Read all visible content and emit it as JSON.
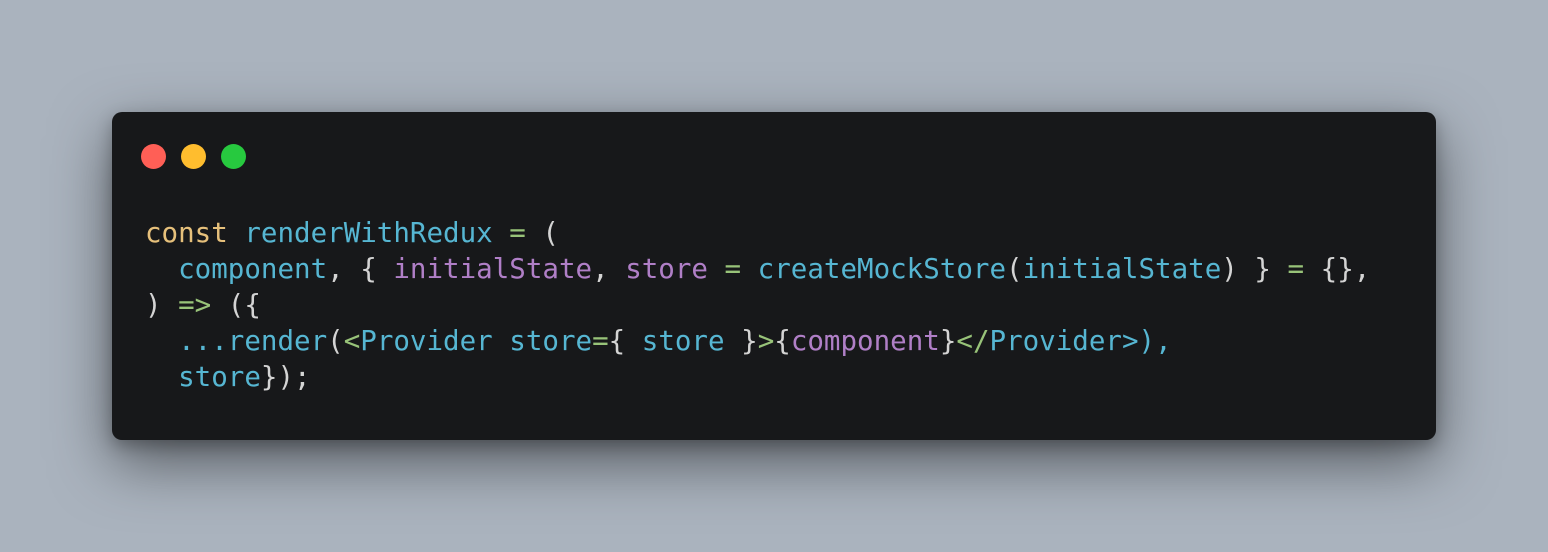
{
  "window": {
    "controls": [
      {
        "name": "close",
        "color": "#ff5f56"
      },
      {
        "name": "minimize",
        "color": "#ffbd2e"
      },
      {
        "name": "maximize",
        "color": "#27c93f"
      }
    ]
  },
  "colors": {
    "keyword": "#e6c07b",
    "identifier": "#56b6d2",
    "parameter": "#b07fc7",
    "operator": "#98c379",
    "punctuation": "#d4d4d4"
  },
  "code": {
    "lines": [
      [
        {
          "text": "const",
          "kind": "keyword"
        },
        {
          "text": " ",
          "kind": "punctuation"
        },
        {
          "text": "renderWithRedux",
          "kind": "identifier"
        },
        {
          "text": " ",
          "kind": "punctuation"
        },
        {
          "text": "=",
          "kind": "operator"
        },
        {
          "text": " (",
          "kind": "punctuation"
        }
      ],
      [
        {
          "text": "  ",
          "kind": "punctuation"
        },
        {
          "text": "component",
          "kind": "identifier"
        },
        {
          "text": ", { ",
          "kind": "punctuation"
        },
        {
          "text": "initialState",
          "kind": "parameter"
        },
        {
          "text": ", ",
          "kind": "punctuation"
        },
        {
          "text": "store",
          "kind": "parameter"
        },
        {
          "text": " ",
          "kind": "punctuation"
        },
        {
          "text": "=",
          "kind": "operator"
        },
        {
          "text": " ",
          "kind": "punctuation"
        },
        {
          "text": "createMockStore",
          "kind": "identifier"
        },
        {
          "text": "(",
          "kind": "punctuation"
        },
        {
          "text": "initialState",
          "kind": "identifier"
        },
        {
          "text": ") } ",
          "kind": "punctuation"
        },
        {
          "text": "=",
          "kind": "operator"
        },
        {
          "text": " {},",
          "kind": "punctuation"
        }
      ],
      [
        {
          "text": ") ",
          "kind": "punctuation"
        },
        {
          "text": "=>",
          "kind": "operator"
        },
        {
          "text": " ({",
          "kind": "punctuation"
        }
      ],
      [
        {
          "text": "  ",
          "kind": "punctuation"
        },
        {
          "text": "...render",
          "kind": "identifier"
        },
        {
          "text": "(",
          "kind": "punctuation"
        },
        {
          "text": "<",
          "kind": "operator"
        },
        {
          "text": "Provider",
          "kind": "identifier"
        },
        {
          "text": " ",
          "kind": "punctuation"
        },
        {
          "text": "store",
          "kind": "identifier"
        },
        {
          "text": "=",
          "kind": "operator"
        },
        {
          "text": "{ ",
          "kind": "punctuation"
        },
        {
          "text": "store",
          "kind": "identifier"
        },
        {
          "text": " }",
          "kind": "punctuation"
        },
        {
          "text": ">",
          "kind": "operator"
        },
        {
          "text": "{",
          "kind": "punctuation"
        },
        {
          "text": "component",
          "kind": "parameter"
        },
        {
          "text": "}",
          "kind": "punctuation"
        },
        {
          "text": "</",
          "kind": "operator"
        },
        {
          "text": "Provider>),",
          "kind": "identifier"
        }
      ],
      [
        {
          "text": "  ",
          "kind": "punctuation"
        },
        {
          "text": "store",
          "kind": "identifier"
        },
        {
          "text": "});",
          "kind": "punctuation"
        }
      ]
    ]
  }
}
